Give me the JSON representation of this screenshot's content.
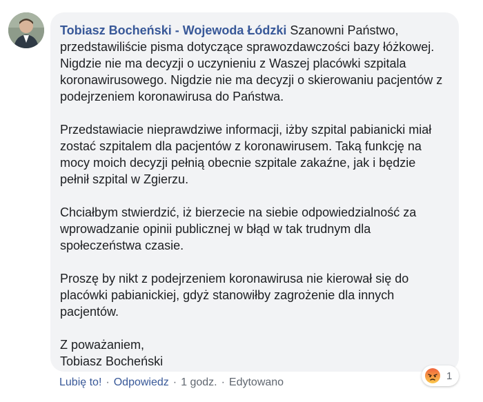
{
  "comment": {
    "author": "Tobiasz Bocheński - Wojewoda Łódzki",
    "paragraphs": [
      "Szanowni Państwo, przedstawiliście pisma dotyczące sprawozdawczości bazy łóżkowej. Nigdzie nie ma decyzji o uczynieniu z Waszej placówki szpitala koronawirusowego. Nigdzie nie ma decyzji o skierowaniu pacjentów z podejrzeniem koronawirusa do Państwa.",
      "Przedstawiacie nieprawdziwe informacji, iżby szpital pabianicki miał zostać szpitalem dla pacjentów z koronawirusem. Taką funkcję na mocy moich decyzji pełnią obecnie szpitale zakaźne, jak i będzie pełnił szpital w Zgierzu.",
      "Chciałbym stwierdzić, iż bierzecie na siebie odpowiedzialność za wprowadzanie opinii publicznej w błąd w tak trudnym dla społeczeństwa czasie.",
      "Proszę by nikt z podejrzeniem koronawirusa nie kierował się do placówki pabianickiej, gdyż stanowiłby zagrożenie dla innych pacjentów."
    ],
    "signoff_line1": "Z poważaniem,",
    "signoff_line2": "Tobiasz Bocheński"
  },
  "actions": {
    "like": "Lubię to!",
    "reply": "Odpowiedz",
    "time": "1 godz.",
    "edited": "Edytowano",
    "separator": "·"
  },
  "reaction": {
    "icon": "angry-reaction-icon",
    "count": "1",
    "color": "#f0643c"
  }
}
